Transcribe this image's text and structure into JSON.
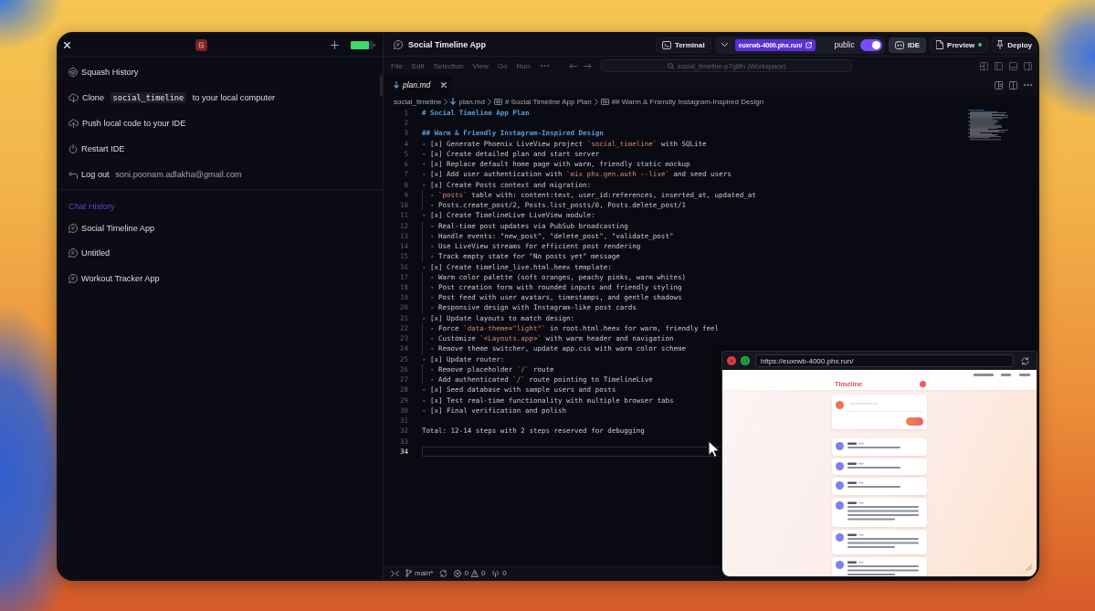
{
  "sidebar": {
    "actions": [
      {
        "kind": "squash",
        "label": "Squash History"
      },
      {
        "kind": "clone",
        "label": "Clone",
        "code": "social_timeline",
        "after": "to your local computer"
      },
      {
        "kind": "push",
        "label": "Push local code to your IDE"
      },
      {
        "kind": "restart",
        "label": "Restart IDE"
      },
      {
        "kind": "logout",
        "label": "Log out",
        "detail": "soni.poonam.adlakha@gmail.com"
      }
    ],
    "chat_history": {
      "title": "Chat History",
      "items": [
        {
          "label": "Social Timeline App",
          "selected": false
        },
        {
          "label": "Untitled",
          "selected": false
        },
        {
          "label": "Workout Tracker App",
          "selected": false
        }
      ]
    }
  },
  "topbar": {
    "title": "Social Timeline App",
    "terminal": "Terminal",
    "url": "euxrwb-4000.phx.run/",
    "visibility": {
      "label": "public",
      "on": true
    },
    "views": [
      {
        "kind": "ide",
        "label": "IDE",
        "selected": true,
        "running": false
      },
      {
        "kind": "preview",
        "label": "Preview",
        "selected": false,
        "running": true
      }
    ],
    "deploy": "Deploy"
  },
  "editor": {
    "menu": [
      "File",
      "Edit",
      "Selection",
      "View",
      "Go",
      "Run"
    ],
    "command_center": "social_timeline-p7g8fn (Workspace)",
    "tabs": [
      {
        "label": "plan.md",
        "selected": true,
        "preview": true
      }
    ],
    "breadcrumb": [
      {
        "kind": "folder",
        "label": "social_timeline"
      },
      {
        "kind": "file",
        "label": "plan.md"
      },
      {
        "kind": "symbol",
        "label": "# Social Timeline App Plan"
      },
      {
        "kind": "symbol",
        "label": "## Warm & Friendly Instagram-Inspired Design"
      }
    ],
    "lines": [
      {
        "number": "1",
        "kind": "heading",
        "current": false,
        "segments": [
          {
            "kind": "plain",
            "text": "# Social Timeline App Plan"
          }
        ]
      },
      {
        "number": "2",
        "kind": "blank",
        "current": false
      },
      {
        "number": "3",
        "kind": "heading",
        "current": false,
        "segments": [
          {
            "kind": "plain",
            "text": "## Warm & Friendly Instagram-Inspired Design"
          }
        ]
      },
      {
        "number": "4",
        "kind": "item",
        "current": false,
        "segments": [
          {
            "kind": "plain",
            "text": "- [x] Generate Phoenix LiveView project "
          },
          {
            "kind": "code",
            "text": "`social_timeline`"
          },
          {
            "kind": "plain",
            "text": " with SQLite"
          }
        ]
      },
      {
        "number": "5",
        "kind": "item",
        "current": false,
        "segments": [
          {
            "kind": "plain",
            "text": "- [x] Create detailed plan and start server"
          }
        ]
      },
      {
        "number": "6",
        "kind": "item",
        "current": false,
        "segments": [
          {
            "kind": "plain",
            "text": "- [x] Replace default home page with warm, friendly static mockup"
          }
        ]
      },
      {
        "number": "7",
        "kind": "item",
        "current": false,
        "segments": [
          {
            "kind": "plain",
            "text": "- [x] Add user authentication with "
          },
          {
            "kind": "code",
            "text": "`mix phx.gen.auth --live`"
          },
          {
            "kind": "plain",
            "text": " and seed users"
          }
        ]
      },
      {
        "number": "8",
        "kind": "item",
        "current": false,
        "segments": [
          {
            "kind": "plain",
            "text": "- [x] Create Posts context and migration:"
          }
        ]
      },
      {
        "number": "9",
        "kind": "subitem",
        "current": false,
        "segments": [
          {
            "kind": "plain",
            "text": "- "
          },
          {
            "kind": "code",
            "text": "`posts`"
          },
          {
            "kind": "plain",
            "text": " table with: content:text, user_id:references, inserted_at, updated_at"
          }
        ]
      },
      {
        "number": "10",
        "kind": "subitem",
        "current": false,
        "segments": [
          {
            "kind": "plain",
            "text": "- Posts.create_post/2, Posts.list_posts/0, Posts.delete_post/1"
          }
        ]
      },
      {
        "number": "11",
        "kind": "item",
        "current": false,
        "segments": [
          {
            "kind": "plain",
            "text": "- [x] Create TimelineLive LiveView module:"
          }
        ]
      },
      {
        "number": "12",
        "kind": "subitem",
        "current": false,
        "segments": [
          {
            "kind": "plain",
            "text": "- Real-time post updates via PubSub broadcasting"
          }
        ]
      },
      {
        "number": "13",
        "kind": "subitem",
        "current": false,
        "segments": [
          {
            "kind": "plain",
            "text": "- Handle events: \"new_post\", \"delete_post\", \"validate_post\""
          }
        ]
      },
      {
        "number": "14",
        "kind": "subitem",
        "current": false,
        "segments": [
          {
            "kind": "plain",
            "text": "- Use LiveView streams for efficient post rendering"
          }
        ]
      },
      {
        "number": "15",
        "kind": "subitem",
        "current": false,
        "segments": [
          {
            "kind": "plain",
            "text": "- Track empty state for \"No posts yet\" message"
          }
        ]
      },
      {
        "number": "16",
        "kind": "item",
        "current": false,
        "segments": [
          {
            "kind": "plain",
            "text": "- [x] Create timeline_live.html.heex template:"
          }
        ]
      },
      {
        "number": "17",
        "kind": "subitem",
        "current": false,
        "segments": [
          {
            "kind": "plain",
            "text": "- Warm color palette (soft oranges, peachy pinks, warm whites)"
          }
        ]
      },
      {
        "number": "18",
        "kind": "subitem",
        "current": false,
        "segments": [
          {
            "kind": "plain",
            "text": "- Post creation form with rounded inputs and friendly styling"
          }
        ]
      },
      {
        "number": "19",
        "kind": "subitem",
        "current": false,
        "segments": [
          {
            "kind": "plain",
            "text": "- Post feed with user avatars, timestamps, and gentle shadows"
          }
        ]
      },
      {
        "number": "20",
        "kind": "subitem",
        "current": false,
        "segments": [
          {
            "kind": "plain",
            "text": "- Responsive design with Instagram-like post cards"
          }
        ]
      },
      {
        "number": "21",
        "kind": "item",
        "current": false,
        "segments": [
          {
            "kind": "plain",
            "text": "- [x] Update layouts to match design:"
          }
        ]
      },
      {
        "number": "22",
        "kind": "subitem",
        "current": false,
        "segments": [
          {
            "kind": "plain",
            "text": "- Force "
          },
          {
            "kind": "code",
            "text": "`data-theme=\"light\"`"
          },
          {
            "kind": "plain",
            "text": " in root.html.heex for warm, friendly feel"
          }
        ]
      },
      {
        "number": "23",
        "kind": "subitem",
        "current": false,
        "segments": [
          {
            "kind": "plain",
            "text": "- Customize "
          },
          {
            "kind": "code",
            "text": "`<Layouts.app>`"
          },
          {
            "kind": "plain",
            "text": " with warm header and navigation"
          }
        ]
      },
      {
        "number": "24",
        "kind": "subitem",
        "current": false,
        "segments": [
          {
            "kind": "plain",
            "text": "- Remove theme switcher, update app.css with warm color scheme"
          }
        ]
      },
      {
        "number": "25",
        "kind": "item",
        "current": false,
        "segments": [
          {
            "kind": "plain",
            "text": "- [x] Update router:"
          }
        ]
      },
      {
        "number": "26",
        "kind": "subitem",
        "current": false,
        "segments": [
          {
            "kind": "plain",
            "text": "- Remove placeholder "
          },
          {
            "kind": "code",
            "text": "`/`"
          },
          {
            "kind": "plain",
            "text": " route"
          }
        ]
      },
      {
        "number": "27",
        "kind": "subitem",
        "current": false,
        "segments": [
          {
            "kind": "plain",
            "text": "- Add authenticated "
          },
          {
            "kind": "code",
            "text": "`/`"
          },
          {
            "kind": "plain",
            "text": " route pointing to TimelineLive"
          }
        ]
      },
      {
        "number": "28",
        "kind": "item",
        "current": false,
        "segments": [
          {
            "kind": "plain",
            "text": "- [x] Seed database with sample users and posts"
          }
        ]
      },
      {
        "number": "29",
        "kind": "item",
        "current": false,
        "segments": [
          {
            "kind": "plain",
            "text": "- [x] Test real-time functionality with multiple browser tabs"
          }
        ]
      },
      {
        "number": "30",
        "kind": "item",
        "current": false,
        "segments": [
          {
            "kind": "plain",
            "text": "- [x] Final verification and polish"
          }
        ]
      },
      {
        "number": "31",
        "kind": "blank",
        "current": false
      },
      {
        "number": "32",
        "kind": "text",
        "current": false,
        "segments": [
          {
            "kind": "plain",
            "text": "Total: 12-14 steps with 2 steps reserved for debugging"
          }
        ]
      },
      {
        "number": "33",
        "kind": "blank",
        "current": false
      },
      {
        "number": "34",
        "kind": "blank",
        "current": true
      }
    ]
  },
  "status_bar": {
    "branch": "main*",
    "errors": "0",
    "warnings": "0",
    "ports": "0"
  },
  "preview": {
    "url": "https://euxrwb-4000.phx.run/",
    "page_title": "Timeline",
    "posts": [
      {
        "kind": "short"
      },
      {
        "kind": "short"
      },
      {
        "kind": "short"
      },
      {
        "kind": "long"
      },
      {
        "kind": "medium"
      },
      {
        "kind": "medium"
      }
    ]
  }
}
